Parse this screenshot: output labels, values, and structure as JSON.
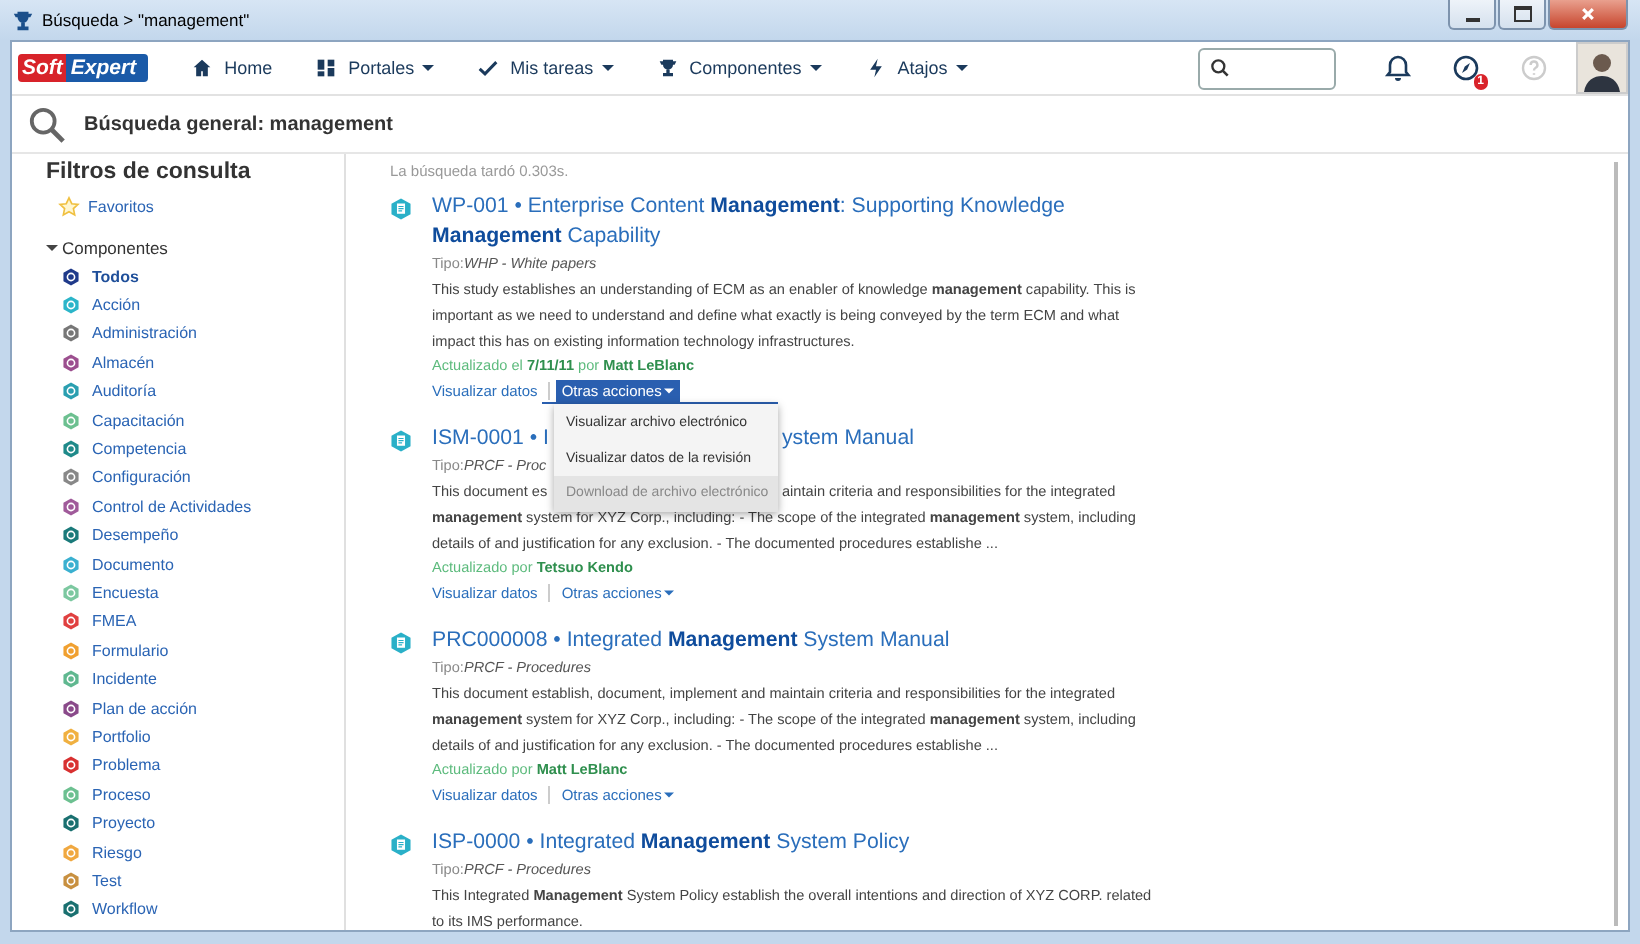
{
  "window": {
    "title": "Búsqueda > \"management\""
  },
  "nav": {
    "logo_left": "Soft",
    "logo_right": "Expert",
    "items": [
      {
        "label": "Home",
        "dropdown": false
      },
      {
        "label": "Portales",
        "dropdown": true
      },
      {
        "label": "Mis tareas",
        "dropdown": true
      },
      {
        "label": "Componentes",
        "dropdown": true
      },
      {
        "label": "Atajos",
        "dropdown": true
      }
    ],
    "notification_badge": "1"
  },
  "page_header": {
    "title": "Búsqueda general: management"
  },
  "sidebar": {
    "title": "Filtros de consulta",
    "favorites": "Favoritos",
    "section": {
      "label": "Componentes",
      "expanded": true,
      "items": [
        {
          "label": "Todos",
          "color": "#1f3a8a",
          "selected": true
        },
        {
          "label": "Acción",
          "color": "#2bb5c9",
          "selected": false
        },
        {
          "label": "Administración",
          "color": "#777777",
          "selected": false
        },
        {
          "label": "Almacén",
          "color": "#9c4f8f",
          "selected": false
        },
        {
          "label": "Auditoría",
          "color": "#2a9fb0",
          "selected": false
        },
        {
          "label": "Capacitación",
          "color": "#6cc090",
          "selected": false
        },
        {
          "label": "Competencia",
          "color": "#1f8a8a",
          "selected": false
        },
        {
          "label": "Configuración",
          "color": "#888888",
          "selected": false
        },
        {
          "label": "Control de Actividades",
          "color": "#a05a9a",
          "selected": false
        },
        {
          "label": "Desempeño",
          "color": "#1a7a7a",
          "selected": false
        },
        {
          "label": "Documento",
          "color": "#3ab0d0",
          "selected": false
        },
        {
          "label": "Encuesta",
          "color": "#7cc8a0",
          "selected": false
        },
        {
          "label": "FMEA",
          "color": "#e04040",
          "selected": false
        },
        {
          "label": "Formulario",
          "color": "#f0a030",
          "selected": false
        },
        {
          "label": "Incidente",
          "color": "#60b890",
          "selected": false
        },
        {
          "label": "Plan de acción",
          "color": "#8a4a8a",
          "selected": false
        },
        {
          "label": "Portfolio",
          "color": "#f0b040",
          "selected": false
        },
        {
          "label": "Problema",
          "color": "#d83030",
          "selected": false
        },
        {
          "label": "Proceso",
          "color": "#6cc090",
          "selected": false
        },
        {
          "label": "Proyecto",
          "color": "#1a7070",
          "selected": false
        },
        {
          "label": "Riesgo",
          "color": "#f0a840",
          "selected": false
        },
        {
          "label": "Test",
          "color": "#c89040",
          "selected": false
        },
        {
          "label": "Workflow",
          "color": "#1a7070",
          "selected": false
        }
      ]
    }
  },
  "results": {
    "timing": "La búsqueda tardó 0.303s.",
    "items": [
      {
        "title": [
          "WP-001 • Enterprise Content **Management**: Supporting Knowledge",
          "**Management** Capability"
        ],
        "type": "Tipo:*WHP - White papers*",
        "description": [
          "This study establishes an understanding of ECM as an enabler of knowledge **management** capability. This is",
          "important as we need to understand and define what exactly is being conveyed by the term ECM and what",
          "impact this has on existing information technology infrastructures."
        ],
        "updated": "Actualizado el **7/11/11** por **Matt LeBlanc**",
        "view": "Visualizar datos",
        "more": "Otras acciones",
        "open": true
      },
      {
        "title": [
          {
            "left": "ISM-0001 • I",
            "right": "ystem Manual"
          }
        ],
        "type": {
          "left": "Tipo:*PRCF - Proc*"
        },
        "description": [
          {
            "left": "This document es",
            "right": "aintain criteria and responsibilities for the integrated"
          },
          "**management** system for XYZ Corp., including: - The scope of the integrated **management** system, including",
          "details of and justification for any exclusion. - The documented procedures establishe ..."
        ],
        "updated": "Actualizado por **Tetsuo Kendo**",
        "view": "Visualizar datos",
        "more": "Otras acciones",
        "open": false
      },
      {
        "title": [
          "PRC000008 • Integrated **Management** System Manual"
        ],
        "type": "Tipo:*PRCF - Procedures*",
        "description": [
          "This document establish, document, implement and maintain criteria and responsibilities for the integrated",
          "**management** system for XYZ Corp., including: - The scope of the integrated **management** system, including",
          "details of and justification for any exclusion. - The documented procedures establishe ..."
        ],
        "updated": "Actualizado por **Matt LeBlanc**",
        "view": "Visualizar datos",
        "more": "Otras acciones",
        "open": false
      },
      {
        "title": [
          "ISP-0000 • Integrated **Management** System Policy"
        ],
        "type": "Tipo:*PRCF - Procedures*",
        "description": [
          "This Integrated **Management** System Policy establish the overall intentions and direction of XYZ CORP. related",
          "to its IMS performance."
        ]
      }
    ]
  },
  "action_menu": {
    "items": [
      {
        "label": "Visualizar archivo electrónico",
        "disabled": false
      },
      {
        "label": "Visualizar datos de la revisión",
        "disabled": false
      },
      {
        "label": "Download de archivo electrónico",
        "disabled": true
      }
    ]
  }
}
